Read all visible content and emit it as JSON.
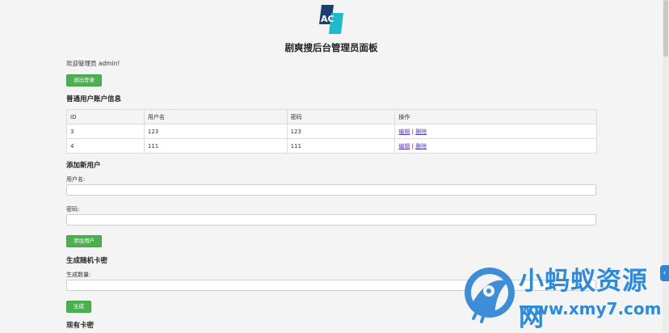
{
  "logo": {
    "text": "AC"
  },
  "header": {
    "title": "剧爽搜后台管理员面板"
  },
  "welcome": {
    "text": "欢迎管理员 admin!"
  },
  "logout": {
    "label": "退出登录"
  },
  "users_section": {
    "title": "普通用户账户信息",
    "columns": [
      "ID",
      "用户名",
      "密码",
      "操作"
    ],
    "rows": [
      {
        "id": "3",
        "username": "123",
        "password": "123",
        "edit": "编辑",
        "sep": "|",
        "delete": "删除"
      },
      {
        "id": "4",
        "username": "111",
        "password": "111",
        "edit": "编辑",
        "sep": "|",
        "delete": "删除"
      }
    ]
  },
  "add_user": {
    "title": "添加新用户",
    "username_label": "用户名:",
    "username_value": "",
    "password_label": "密码:",
    "password_value": "",
    "submit_label": "添加用户"
  },
  "gen_cards": {
    "title": "生成随机卡密",
    "count_label": "生成数量:",
    "count_value": "",
    "submit_label": "生成"
  },
  "existing_cards": {
    "title": "现有卡密"
  },
  "watermark": {
    "cn": "小蚂蚁资源网",
    "url": "www.xmy7.com"
  },
  "side_tab": {
    "glyph": "‹"
  },
  "colors": {
    "button": "#4caf50",
    "watermark": "#2f8ad8",
    "link": "#5b3fa8"
  }
}
